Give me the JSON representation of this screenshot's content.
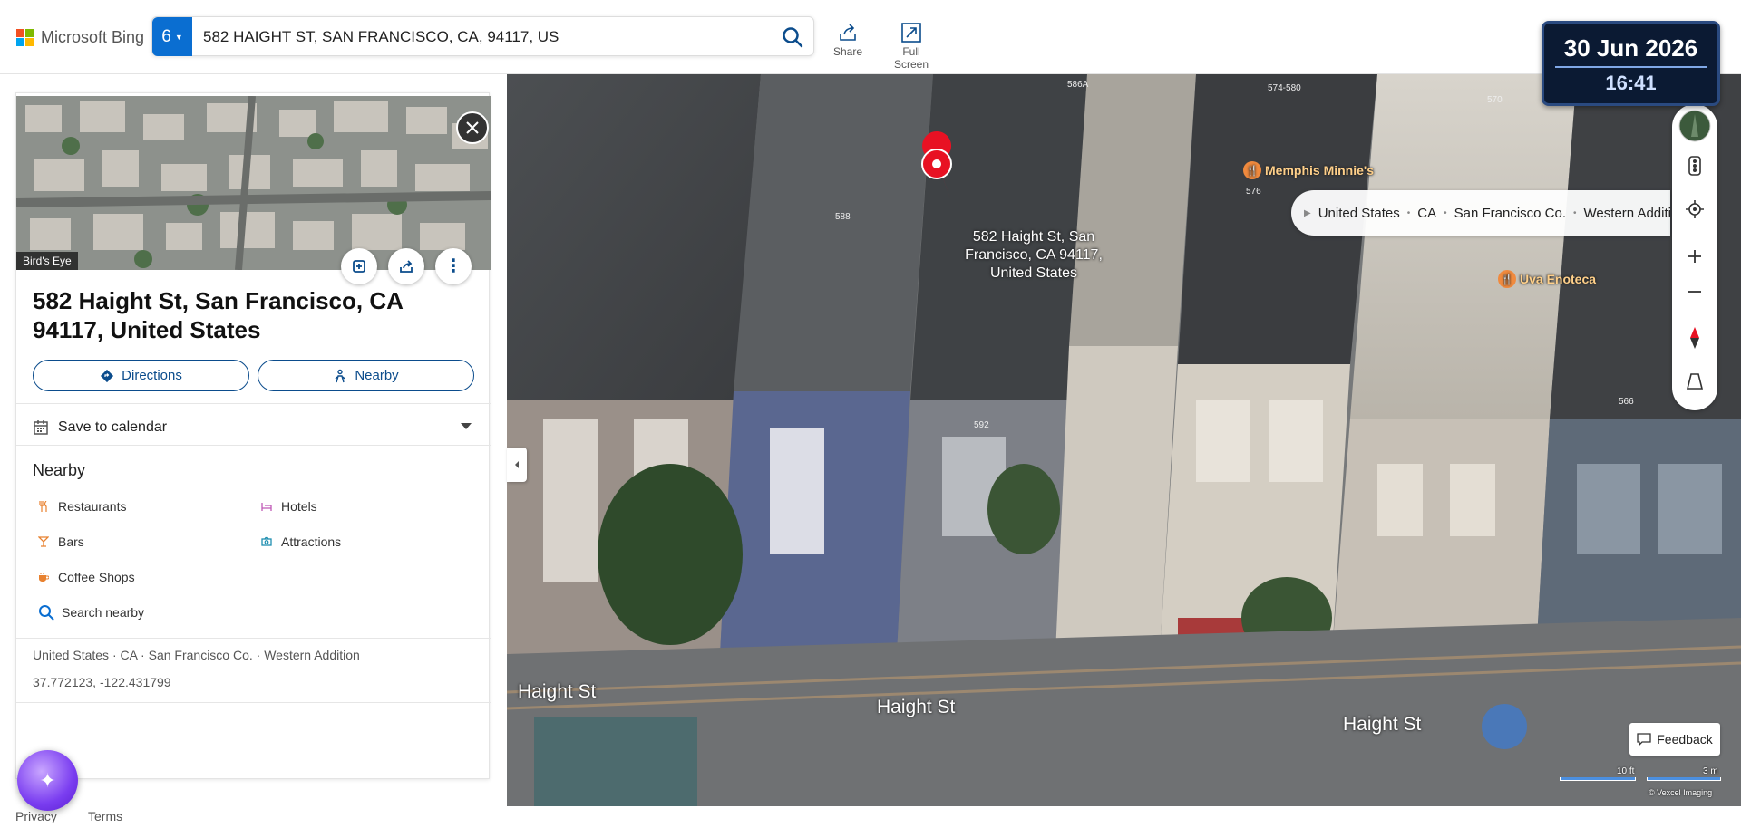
{
  "topbar": {
    "brand": "Microsoft Bing",
    "search_badge": "6",
    "search_value": "582 HAIGHT ST, SAN FRANCISCO, CA, 94117, US",
    "share_label": "Share",
    "fullscreen_label": "Full Screen"
  },
  "datetime": {
    "date": "30 Jun 2026",
    "time": "16:41"
  },
  "panel": {
    "hero_label": "Bird's Eye",
    "title": "582 Haight St, San Francisco, CA 94117, United States",
    "directions_label": "Directions",
    "nearby_label": "Nearby",
    "calendar_label": "Save to calendar",
    "nearby_title": "Nearby",
    "nearby_items": [
      {
        "label": "Restaurants",
        "color": "#e8812f"
      },
      {
        "label": "Hotels",
        "color": "#c05ab7"
      },
      {
        "label": "Bars",
        "color": "#e8812f"
      },
      {
        "label": "Attractions",
        "color": "#1f8fb0"
      },
      {
        "label": "Coffee Shops",
        "color": "#e8812f"
      }
    ],
    "search_nearby": "Search nearby",
    "location_path": "United States · CA · San Francisco Co. · Western Addition",
    "coordinates": "37.772123, -122.431799"
  },
  "footer": {
    "privacy": "Privacy",
    "terms": "Terms"
  },
  "map": {
    "pin_label": "582 Haight St, San Francisco, CA 94117, United States",
    "breadcrumb": [
      "United States",
      "CA",
      "San Francisco Co.",
      "Western Addition"
    ],
    "pois": [
      "Memphis Minnie's",
      "Uva Enoteca"
    ],
    "streets": [
      "Haight St",
      "Haight St",
      "Haight St"
    ],
    "house_numbers": [
      "586A",
      "574-580",
      "570",
      "588",
      "576",
      "592",
      "566"
    ],
    "feedback": "Feedback",
    "scale_ft": "10 ft",
    "scale_m": "3 m",
    "credit": "© Vexcel Imaging"
  },
  "colors": {
    "accent": "#0a6ed1",
    "pin": "#e81123",
    "datetime_bg": "#0b1a33"
  }
}
